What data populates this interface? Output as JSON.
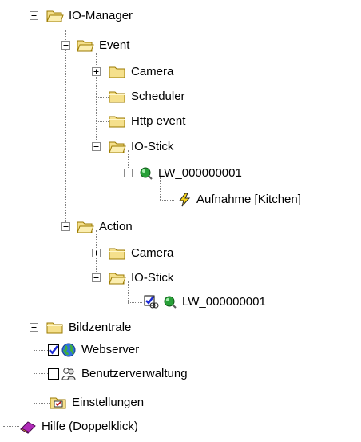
{
  "tree": {
    "io_manager": {
      "label": "IO-Manager"
    },
    "event": {
      "label": "Event"
    },
    "event_camera": {
      "label": "Camera"
    },
    "event_scheduler": {
      "label": "Scheduler"
    },
    "event_http": {
      "label": "Http event"
    },
    "event_iostick": {
      "label": "IO-Stick"
    },
    "event_lw": {
      "label": "LW_000000001"
    },
    "event_aufnahme": {
      "label": "Aufnahme [Kitchen]"
    },
    "action": {
      "label": "Action"
    },
    "action_camera": {
      "label": "Camera"
    },
    "action_iostick": {
      "label": "IO-Stick"
    },
    "action_lw": {
      "label": "LW_000000001"
    },
    "bildzentrale": {
      "label": "Bildzentrale"
    },
    "webserver": {
      "label": "Webserver",
      "checked": true
    },
    "benutzerverwaltung": {
      "label": "Benutzerverwaltung",
      "checked": false
    },
    "einstellungen": {
      "label": "Einstellungen"
    },
    "hilfe": {
      "label": "Hilfe (Doppelklick)"
    }
  },
  "icons": {
    "folder": "folder-icon",
    "open_folder": "open-folder-icon",
    "green_dot": "green-status-icon",
    "lightning": "lightning-icon",
    "globe": "globe-icon",
    "users": "users-icon",
    "settings": "settings-folder-icon",
    "help_book": "help-book-icon"
  },
  "colors": {
    "folder_fill": "#f5e08c",
    "folder_stroke": "#9b7a00",
    "tree_lines": "#808080",
    "check_blue": "#1c2bd6",
    "status_green": "#28a038"
  }
}
